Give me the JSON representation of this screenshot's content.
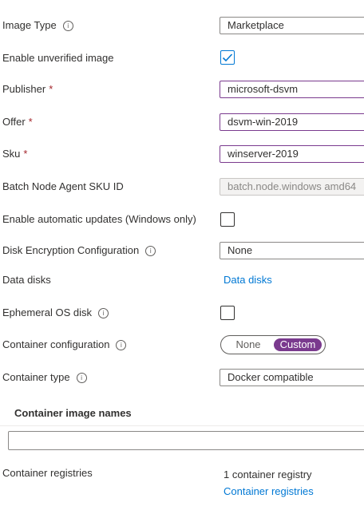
{
  "form": {
    "image_type": {
      "label": "Image Type",
      "value": "Marketplace"
    },
    "enable_unverified": {
      "label": "Enable unverified image",
      "checked": true
    },
    "publisher": {
      "label": "Publisher",
      "value": "microsoft-dsvm"
    },
    "offer": {
      "label": "Offer",
      "value": "dsvm-win-2019"
    },
    "sku": {
      "label": "Sku",
      "value": "winserver-2019"
    },
    "node_agent": {
      "label": "Batch Node Agent SKU ID",
      "value": "batch.node.windows amd64"
    },
    "auto_updates": {
      "label": "Enable automatic updates (Windows only)",
      "checked": false
    },
    "disk_encryption": {
      "label": "Disk Encryption Configuration",
      "value": "None"
    },
    "data_disks": {
      "label": "Data disks",
      "link": "Data disks"
    },
    "ephemeral_os": {
      "label": "Ephemeral OS disk",
      "checked": false
    },
    "container_config": {
      "label": "Container configuration",
      "options": [
        "None",
        "Custom"
      ],
      "selected": "Custom"
    },
    "container_type": {
      "label": "Container type",
      "value": "Docker compatible"
    },
    "container_images": {
      "heading": "Container image names",
      "value": ""
    },
    "container_registries": {
      "label": "Container registries",
      "count_text": "1 container registry",
      "link": "Container registries"
    }
  },
  "required_marker": "*",
  "info_glyph": "i",
  "colors": {
    "accent": "#7a3a8e",
    "link": "#0078d4",
    "required": "#a4262c"
  }
}
